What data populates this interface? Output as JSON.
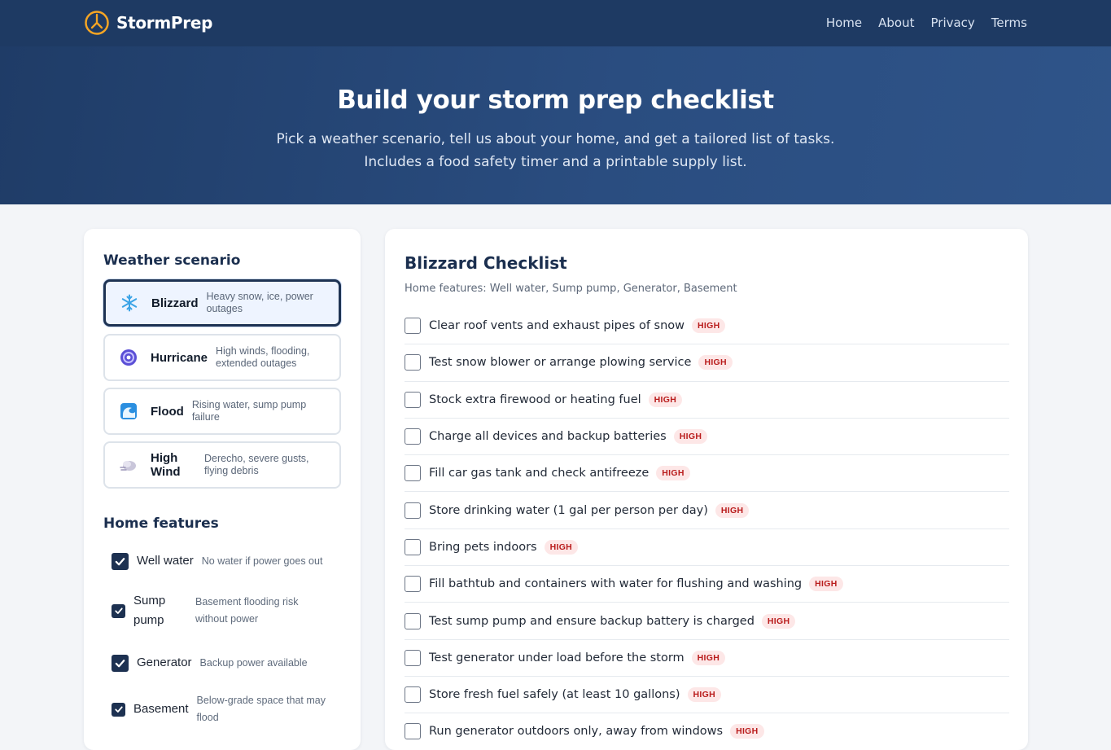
{
  "header": {
    "brand": "StormPrep",
    "nav": [
      "Home",
      "About",
      "Privacy",
      "Terms"
    ]
  },
  "hero": {
    "title": "Build your storm prep checklist",
    "subtitle": "Pick a weather scenario, tell us about your home, and get a tailored list of tasks. Includes a food safety timer and a printable supply list."
  },
  "sidebar": {
    "scenario_title": "Weather scenario",
    "scenarios": [
      {
        "name": "Blizzard",
        "desc": "Heavy snow, ice, power outages",
        "icon": "snowflake-icon",
        "selected": true
      },
      {
        "name": "Hurricane",
        "desc": "High winds, flooding, extended outages",
        "icon": "hurricane-icon",
        "selected": false
      },
      {
        "name": "Flood",
        "desc": "Rising water, sump pump failure",
        "icon": "wave-icon",
        "selected": false
      },
      {
        "name": "High Wind",
        "desc": "Derecho, severe gusts, flying debris",
        "icon": "wind-icon",
        "selected": false
      }
    ],
    "features_title": "Home features",
    "features": [
      {
        "name": "Well water",
        "desc": "No water if power goes out",
        "checked": true
      },
      {
        "name": "Sump pump",
        "desc": "Basement flooding risk without power",
        "checked": true
      },
      {
        "name": "Generator",
        "desc": "Backup power available",
        "checked": true
      },
      {
        "name": "Basement",
        "desc": "Below-grade space that may flood",
        "checked": true
      }
    ]
  },
  "checklist": {
    "title": "Blizzard Checklist",
    "home_features": "Home features: Well water, Sump pump, Generator, Basement",
    "tasks": [
      {
        "label": "Clear roof vents and exhaust pipes of snow",
        "priority": "HIGH"
      },
      {
        "label": "Test snow blower or arrange plowing service",
        "priority": "HIGH"
      },
      {
        "label": "Stock extra firewood or heating fuel",
        "priority": "HIGH"
      },
      {
        "label": "Charge all devices and backup batteries",
        "priority": "HIGH"
      },
      {
        "label": "Fill car gas tank and check antifreeze",
        "priority": "HIGH"
      },
      {
        "label": "Store drinking water (1 gal per person per day)",
        "priority": "HIGH"
      },
      {
        "label": "Bring pets indoors",
        "priority": "HIGH"
      },
      {
        "label": "Fill bathtub and containers with water for flushing and washing",
        "priority": "HIGH"
      },
      {
        "label": "Test sump pump and ensure backup battery is charged",
        "priority": "HIGH"
      },
      {
        "label": "Test generator under load before the storm",
        "priority": "HIGH"
      },
      {
        "label": "Store fresh fuel safely (at least 10 gallons)",
        "priority": "HIGH"
      },
      {
        "label": "Run generator outdoors only, away from windows",
        "priority": "HIGH"
      }
    ]
  },
  "colors": {
    "header_bg": "#1e3a63",
    "accent_dark": "#1d3151",
    "badge_text": "#b91c1c",
    "badge_bg": "#fde7e7"
  }
}
